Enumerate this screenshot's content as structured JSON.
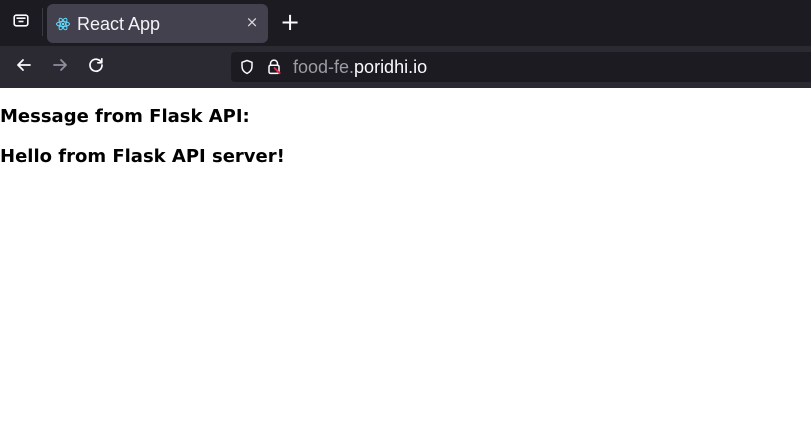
{
  "browser": {
    "tab": {
      "title": "React App",
      "favicon": "react-icon",
      "close": "×"
    },
    "new_tab": "+",
    "nav": {
      "back": "←",
      "forward": "→",
      "reload": "↻"
    },
    "url": {
      "prefix": "food-fe.",
      "domain": "poridhi.io"
    },
    "colors": {
      "chrome": "#1c1b22",
      "tab": "#42414d",
      "toolbar": "#2b2a33",
      "url_dim": "#9c9ca4",
      "url_text": "#fbfbfe",
      "lock_accent": "#e22850"
    }
  },
  "page": {
    "heading": "Message from Flask API:",
    "message": "Hello from Flask API server!"
  }
}
